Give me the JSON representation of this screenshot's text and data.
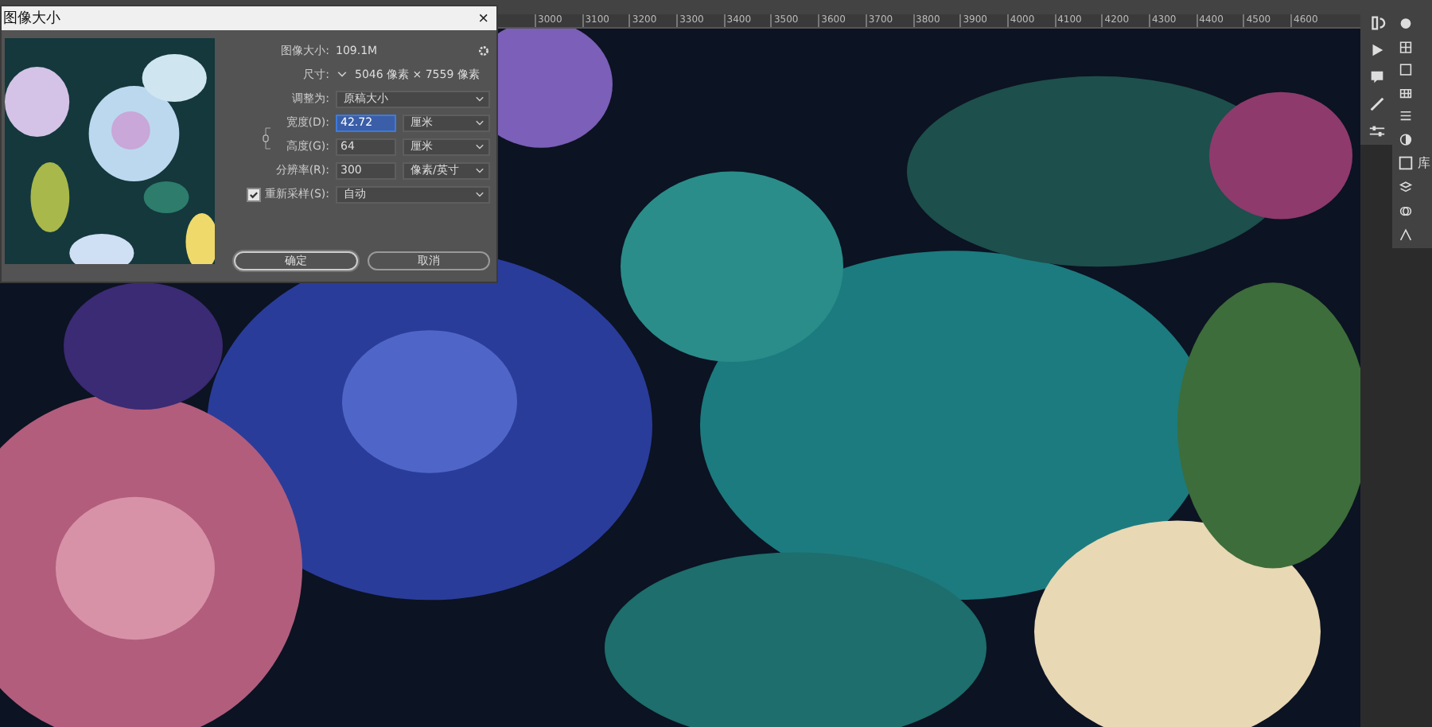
{
  "ruler": {
    "labels": [
      "3000",
      "3100",
      "3200",
      "3300",
      "3400",
      "3500",
      "3600",
      "3700",
      "3800",
      "3900",
      "4000",
      "4100",
      "4200",
      "4300",
      "4400",
      "4500",
      "4600"
    ]
  },
  "dialog": {
    "title": "图像大小",
    "close": "×",
    "image_size": {
      "label": "图像大小:",
      "value": "109.1M"
    },
    "dimensions": {
      "label": "尺寸:",
      "value": "5046 像素 × 7559 像素"
    },
    "fit_to": {
      "label": "调整为:",
      "value": "原稿大小"
    },
    "linked": true,
    "fields": [
      {
        "label": "宽度(D):",
        "value": "42.72",
        "unit": "厘米",
        "selected": true
      },
      {
        "label": "高度(G):",
        "value": "64",
        "unit": "厘米",
        "selected": false
      },
      {
        "label": "分辨率(R):",
        "value": "300",
        "unit": "像素/英寸",
        "selected": false
      }
    ],
    "resample": {
      "label": "重新采样(S):",
      "checked": true,
      "value": "自动"
    },
    "buttons": [
      {
        "label": "确定",
        "default": true
      },
      {
        "label": "取消",
        "default": false
      }
    ]
  },
  "panels": {
    "items": [
      {
        "label": "库"
      }
    ]
  }
}
